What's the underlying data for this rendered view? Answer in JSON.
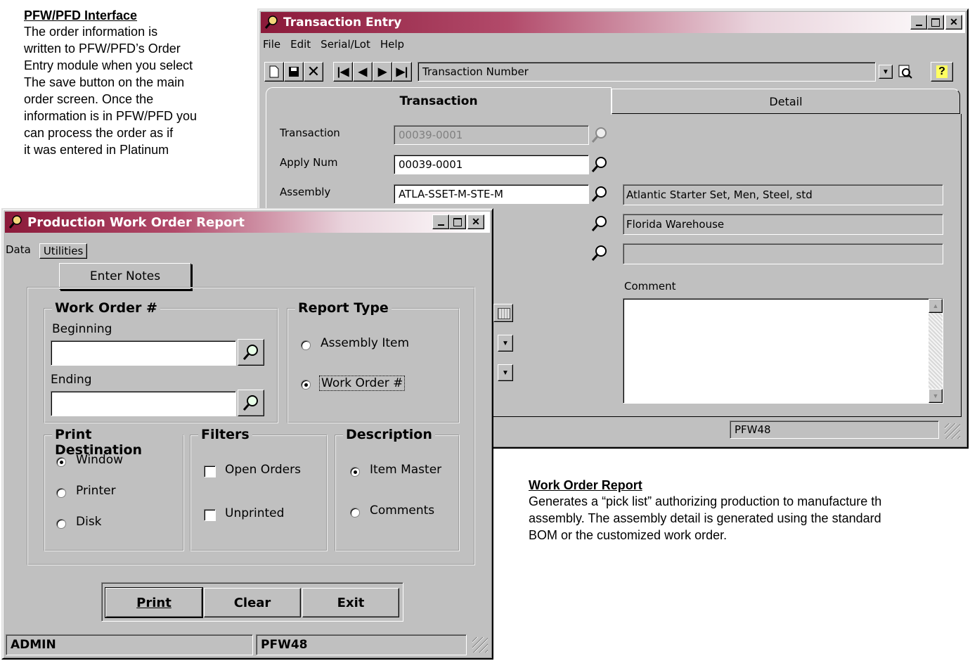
{
  "note_top": {
    "title": "PFW/PFD Interface",
    "lines": [
      "The order information is",
      "written to PFW/PFD’s Order",
      "Entry module when you select",
      "The save button on the main",
      "order screen.  Once the",
      "information is in PFW/PFD you",
      "can process the order as if",
      "it was entered in Platinum"
    ]
  },
  "note_bottom": {
    "title": "Work Order Report",
    "lines": [
      "Generates a “pick list” authorizing production to manufacture th",
      "assembly.  The assembly detail is generated using the standard",
      "BOM or the customized work order."
    ]
  },
  "transaction_entry": {
    "title": "Transaction Entry",
    "menu": [
      "File",
      "Edit",
      "Serial/Lot",
      "Help"
    ],
    "lookup_combo": "Transaction Number",
    "tabs": [
      "Transaction",
      "Detail"
    ],
    "fields": {
      "transaction_label": "Transaction",
      "transaction_value": "00039-0001",
      "apply_label": "Apply Num",
      "apply_value": "00039-0001",
      "assembly_label": "Assembly",
      "assembly_value": "ATLA-SSET-M-STE-M",
      "assembly_desc": "Atlantic Starter Set, Men, Steel, std",
      "warehouse_desc": "Florida Warehouse",
      "comment_label": "Comment"
    },
    "status": "PFW48"
  },
  "work_order_report": {
    "title": "Production Work Order Report",
    "menu": [
      "Data",
      "Utilities"
    ],
    "enter_notes": "Enter Notes",
    "work_order": {
      "legend": "Work Order #",
      "beginning": "Beginning",
      "ending": "Ending"
    },
    "report_type": {
      "legend": "Report Type",
      "options": [
        "Assembly Item",
        "Work Order #"
      ],
      "selected": "Work Order #"
    },
    "print_destination": {
      "legend": "Print Destination",
      "options": [
        "Window",
        "Printer",
        "Disk"
      ],
      "selected": "Window"
    },
    "filters": {
      "legend": "Filters",
      "options": [
        "Open Orders",
        "Unprinted"
      ]
    },
    "description": {
      "legend": "Description",
      "options": [
        "Item Master",
        "Comments"
      ],
      "selected": "Item Master"
    },
    "buttons": [
      "Print",
      "Clear",
      "Exit"
    ],
    "status_user": "ADMIN",
    "status_db": "PFW48"
  }
}
